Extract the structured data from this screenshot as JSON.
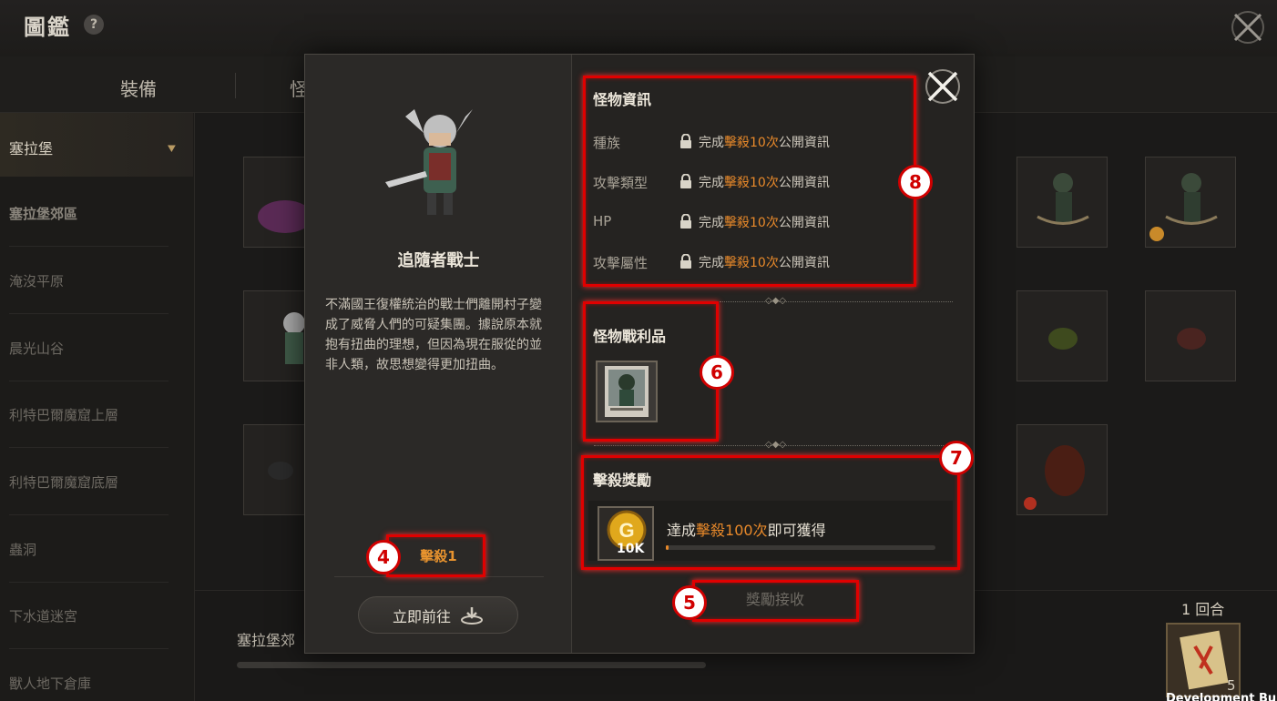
{
  "header": {
    "title": "圖鑑",
    "help_icon": "?"
  },
  "tabs": [
    {
      "label": "裝備"
    },
    {
      "label": "怪"
    }
  ],
  "sidebar": {
    "items": [
      {
        "label": "塞拉堡"
      },
      {
        "label": "塞拉堡郊區"
      },
      {
        "label": "淹沒平原"
      },
      {
        "label": "晨光山谷"
      },
      {
        "label": "利特巴爾魔窟上層"
      },
      {
        "label": "利特巴爾魔窟底層"
      },
      {
        "label": "蟲洞"
      },
      {
        "label": "下水道迷宮"
      },
      {
        "label": "獸人地下倉庫"
      }
    ]
  },
  "bottom": {
    "region_label": "塞拉堡郊",
    "round_label": "1 回合",
    "scroll_count": "5",
    "dev_build": "Development Build"
  },
  "monster": {
    "name": "追隨者戰士",
    "description": "不滿國王復權統治的戰士們離開村子變成了威脅人們的可疑集團。據說原本就抱有扭曲的理想，但因為現在服從的並非人類，故思想變得更加扭曲。",
    "kill_count": "擊殺1",
    "goto_button": "立即前往"
  },
  "monster_info": {
    "title": "怪物資訊",
    "rows": [
      {
        "label": "種族",
        "prefix": "完成",
        "highlight": "擊殺10次",
        "suffix": "公開資訊"
      },
      {
        "label": "攻擊類型",
        "prefix": "完成",
        "highlight": "擊殺10次",
        "suffix": "公開資訊"
      },
      {
        "label": "HP",
        "prefix": "完成",
        "highlight": "擊殺10次",
        "suffix": "公開資訊"
      },
      {
        "label": "攻擊屬性",
        "prefix": "完成",
        "highlight": "擊殺10次",
        "suffix": "公開資訊"
      }
    ]
  },
  "loot": {
    "title": "怪物戰利品"
  },
  "kill_reward": {
    "title": "擊殺獎勵",
    "amount": "10K",
    "text_prefix": "達成",
    "text_highlight": "擊殺100次",
    "text_suffix": "即可獲得",
    "progress": 0.01,
    "claim_button": "獎勵接收"
  },
  "annotations": [
    "4",
    "5",
    "6",
    "7",
    "8"
  ],
  "colors": {
    "accent_orange": "#e8892a",
    "annotation_red": "#e00000"
  }
}
